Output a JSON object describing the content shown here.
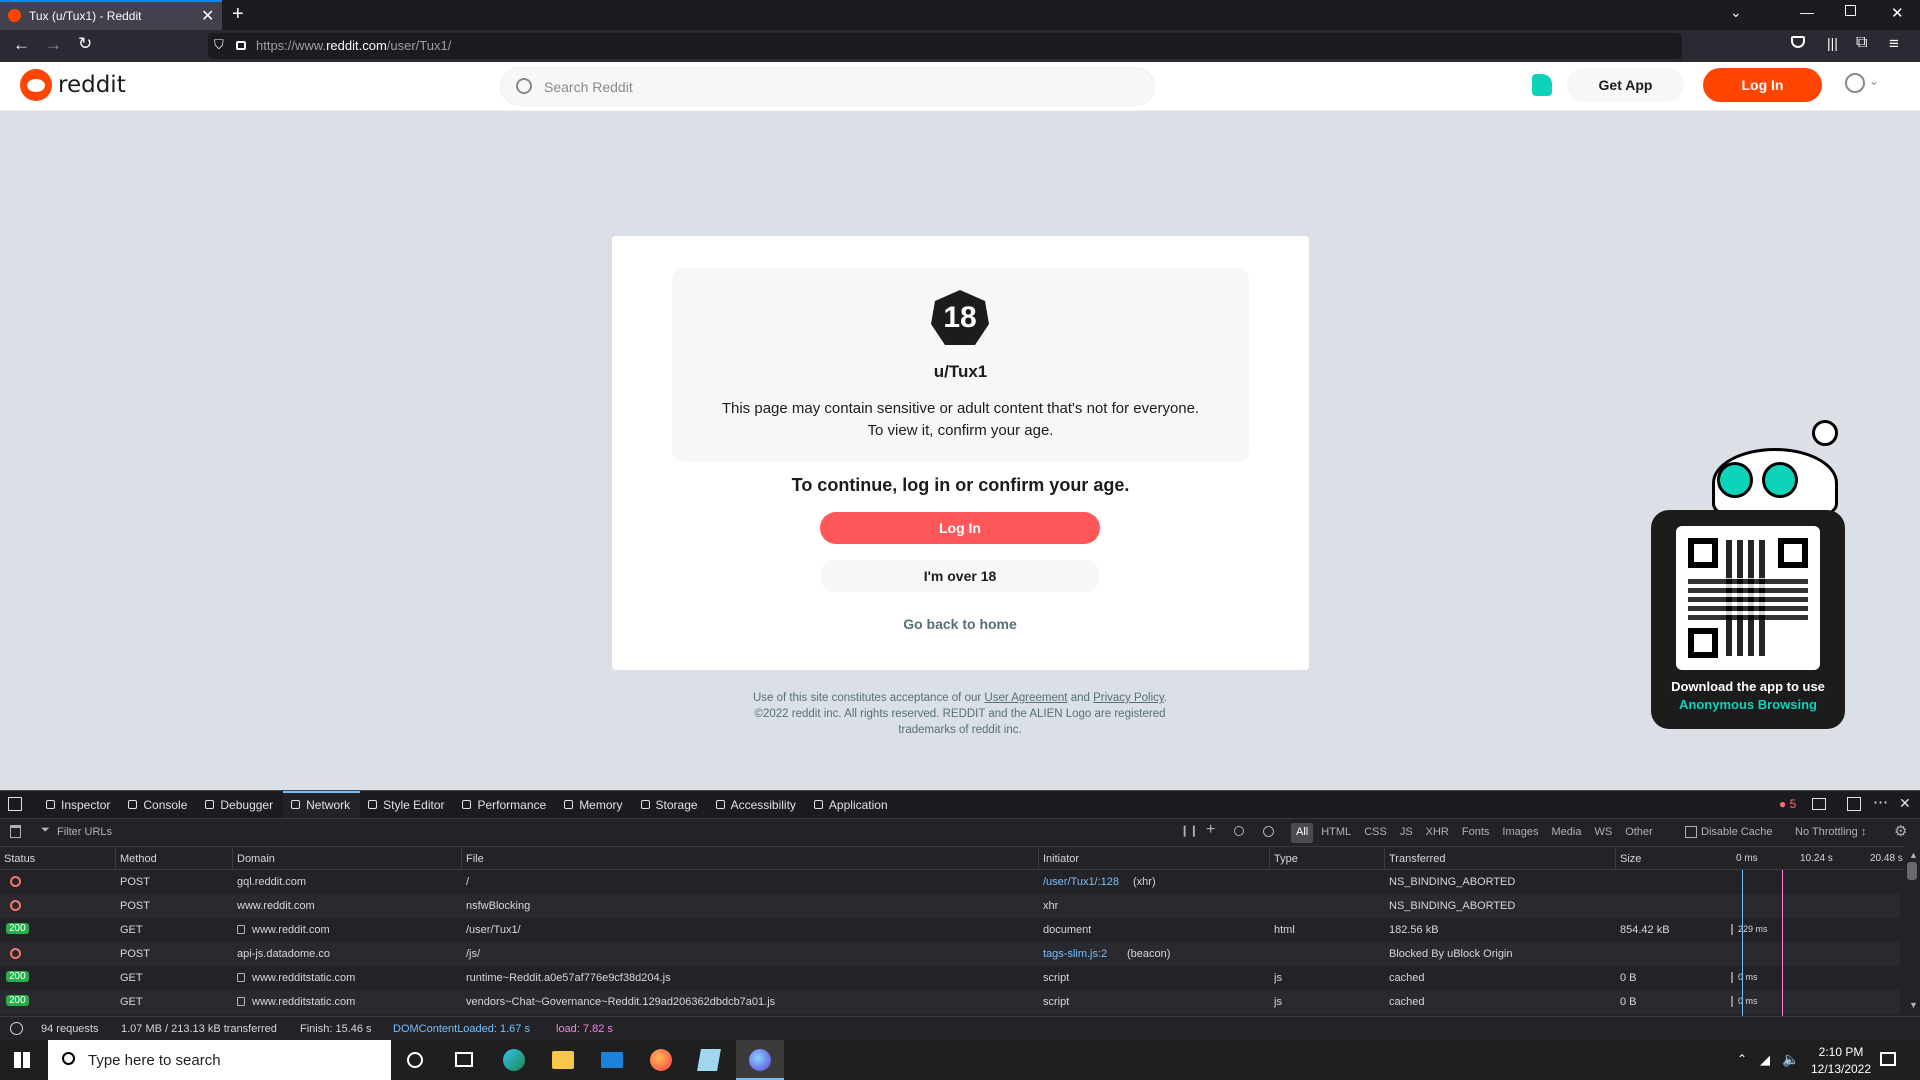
{
  "browser": {
    "tab_title": "Tux (u/Tux1) - Reddit",
    "url_prefix": "https://www.",
    "url_domain": "reddit.com",
    "url_path": "/user/Tux1/"
  },
  "header": {
    "logo_text": "reddit",
    "search_placeholder": "Search Reddit",
    "get_app": "Get App",
    "log_in": "Log In"
  },
  "gate": {
    "badge": "18",
    "username": "u/Tux1",
    "message_line1": "This page may contain sensitive or adult content that's not for everyone.",
    "message_line2": "To view it, confirm your age.",
    "prompt": "To continue, log in or confirm your age.",
    "login_button": "Log In",
    "over18_button": "I'm over 18",
    "home_link": "Go back to home"
  },
  "footer": {
    "prefix": "Use of this site constitutes acceptance of our",
    "user_agreement": "User Agreement",
    "and": "and",
    "privacy": "Privacy Policy",
    "line2": "©2022 reddit inc. All rights reserved. REDDIT and the ALIEN Logo are registered",
    "line3": "trademarks of reddit inc."
  },
  "qr_promo": {
    "line1": "Download the app to use",
    "line2": "Anonymous Browsing"
  },
  "devtools": {
    "tabs": [
      "Inspector",
      "Console",
      "Debugger",
      "Network",
      "Style Editor",
      "Performance",
      "Memory",
      "Storage",
      "Accessibility",
      "Application"
    ],
    "active_tab": "Network",
    "error_count": "5",
    "filter_placeholder": "Filter URLs",
    "type_filters": [
      "All",
      "HTML",
      "CSS",
      "JS",
      "XHR",
      "Fonts",
      "Images",
      "Media",
      "WS",
      "Other"
    ],
    "disable_cache": "Disable Cache",
    "throttling": "No Throttling ↕",
    "columns": [
      "Status",
      "Method",
      "Domain",
      "File",
      "Initiator",
      "Type",
      "Transferred",
      "Size"
    ],
    "timeline_ticks": [
      "0 ms",
      "10.24 s",
      "20.48 s"
    ],
    "rows": [
      {
        "status": "blocked",
        "method": "POST",
        "domain": "gql.reddit.com",
        "secure": false,
        "file": "/",
        "initiator": "/user/Tux1/:128",
        "initiator_suffix": " (xhr)",
        "type": "",
        "transferred": "NS_BINDING_ABORTED",
        "size": "",
        "timing": ""
      },
      {
        "status": "blocked",
        "method": "POST",
        "domain": "www.reddit.com",
        "secure": false,
        "file": "nsfwBlocking",
        "initiator": "",
        "initiator_suffix": "xhr",
        "type": "",
        "transferred": "NS_BINDING_ABORTED",
        "size": "",
        "timing": ""
      },
      {
        "status": "200",
        "method": "GET",
        "domain": "www.reddit.com",
        "secure": true,
        "file": "/user/Tux1/",
        "initiator": "",
        "initiator_suffix": "document",
        "type": "html",
        "transferred": "182.56 kB",
        "size": "854.42 kB",
        "timing": "229 ms"
      },
      {
        "status": "blocked",
        "method": "POST",
        "domain": "api-js.datadome.co",
        "secure": false,
        "file": "/js/",
        "initiator": "tags-slim.js:2",
        "initiator_suffix": " (beacon)",
        "type": "",
        "transferred": "Blocked By uBlock Origin",
        "size": "",
        "timing": ""
      },
      {
        "status": "200",
        "method": "GET",
        "domain": "www.redditstatic.com",
        "secure": true,
        "file": "runtime~Reddit.a0e57af776e9cf38d204.js",
        "initiator": "",
        "initiator_suffix": "script",
        "type": "js",
        "transferred": "cached",
        "size": "0 B",
        "timing": "0 ms"
      },
      {
        "status": "200",
        "method": "GET",
        "domain": "www.redditstatic.com",
        "secure": true,
        "file": "vendors~Chat~Governance~Reddit.129ad206362dbdcb7a01.js",
        "initiator": "",
        "initiator_suffix": "script",
        "type": "js",
        "transferred": "cached",
        "size": "0 B",
        "timing": "0 ms"
      }
    ],
    "summary": {
      "requests": "94 requests",
      "transferred": "1.07 MB / 213.13 kB transferred",
      "finish": "Finish: 15.46 s",
      "dom": "DOMContentLoaded: 1.67 s",
      "load": "load: 7.82 s"
    }
  },
  "taskbar": {
    "search_placeholder": "Type here to search",
    "time": "2:10 PM",
    "date": "12/13/2022"
  },
  "colors": {
    "reddit_orange": "#ff4500",
    "login_button": "#ff585b",
    "devtools_blue": "#75bfff",
    "status_ok": "#2aae4a"
  }
}
